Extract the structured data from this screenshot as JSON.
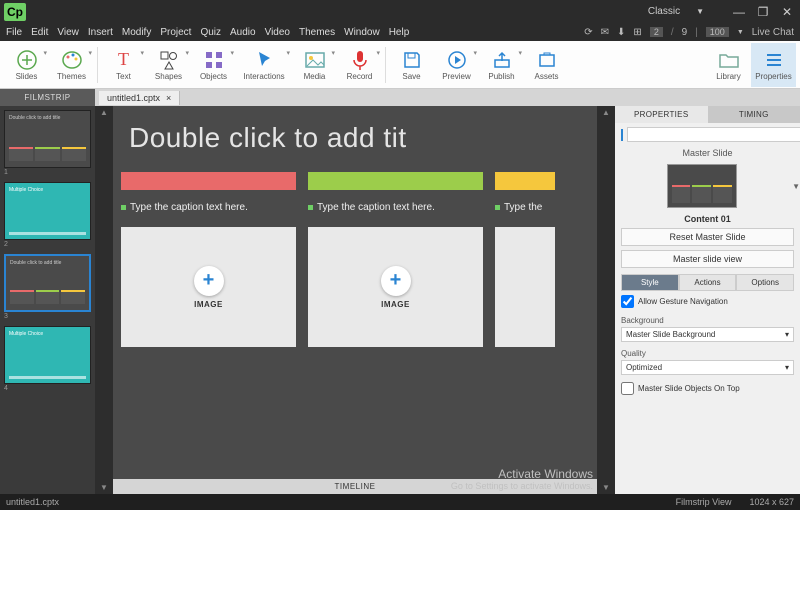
{
  "app_logo": "Cp",
  "workspace": {
    "label": "Classic"
  },
  "window_buttons": {
    "min": "—",
    "restore": "❐",
    "close": "✕"
  },
  "menus": [
    "File",
    "Edit",
    "View",
    "Insert",
    "Modify",
    "Project",
    "Quiz",
    "Audio",
    "Video",
    "Themes",
    "Window",
    "Help"
  ],
  "menu_right": {
    "current": "2",
    "total": "9",
    "zoom": "100",
    "live_chat": "Live Chat"
  },
  "ribbon": [
    {
      "label": "Slides",
      "icon": "plus",
      "color": "#5aa84e"
    },
    {
      "label": "Themes",
      "icon": "palette",
      "color": "#5aa84e"
    },
    {
      "gap": true
    },
    {
      "label": "Text",
      "icon": "T",
      "color": "#d44"
    },
    {
      "label": "Shapes",
      "icon": "shapes",
      "color": "#333"
    },
    {
      "label": "Objects",
      "icon": "grid",
      "color": "#866bc7"
    },
    {
      "label": "Interactions",
      "icon": "cursor",
      "color": "#2a84d2"
    },
    {
      "label": "Media",
      "icon": "image",
      "color": "#6aa"
    },
    {
      "label": "Record",
      "icon": "mic",
      "color": "#d33"
    },
    {
      "gap": true
    },
    {
      "label": "Save",
      "icon": "floppy",
      "color": "#2a84d2"
    },
    {
      "label": "Preview",
      "icon": "play",
      "color": "#2a84d2"
    },
    {
      "label": "Publish",
      "icon": "publish",
      "color": "#2a84d2"
    },
    {
      "label": "Assets",
      "icon": "asset",
      "color": "#2a84d2"
    },
    {
      "spacer": true
    },
    {
      "label": "Library",
      "icon": "folder",
      "color": "#7a9"
    },
    {
      "label": "Properties",
      "icon": "lines",
      "color": "#2a84d2",
      "active": true
    }
  ],
  "filmstrip_header": "FILMSTRIP",
  "document_tab": {
    "name": "untitled1.cptx",
    "close": "×"
  },
  "thumbs": [
    {
      "label": "Double click to add title",
      "type": "cards",
      "sel": true,
      "n": "1"
    },
    {
      "label": "Multiple Choice",
      "type": "quiz",
      "n": "2"
    },
    {
      "label": "Double click to add title",
      "type": "cards",
      "sel": true,
      "n": "3"
    },
    {
      "label": "Multiple Choice",
      "type": "quiz",
      "n": "4"
    }
  ],
  "colors": {
    "red": "#e86a6a",
    "green": "#9ccd4b",
    "yellow": "#f5c73d",
    "teal": "#2fb7b3"
  },
  "canvas": {
    "title": "Double click to add tit",
    "caption": "Type the caption text here.",
    "caption3": "Type the",
    "image_label": "IMAGE"
  },
  "timeline": "TIMELINE",
  "properties": {
    "tabs": [
      "PROPERTIES",
      "TIMING"
    ],
    "name": "",
    "master_heading": "Master Slide",
    "master_name": "Content 01",
    "reset_btn": "Reset Master Slide",
    "view_btn": "Master slide view",
    "subtabs": [
      "Style",
      "Actions",
      "Options"
    ],
    "gesture": "Allow Gesture Navigation",
    "bg_label": "Background",
    "bg_value": "Master Slide Background",
    "quality_label": "Quality",
    "quality_value": "Optimized",
    "ontop": "Master Slide Objects On Top"
  },
  "watermark": {
    "line1": "Activate Windows",
    "line2": "Go to Settings to activate Windows."
  },
  "statusbar": {
    "file": "untitled1.cptx",
    "view": "Filmstrip View",
    "dims": "1024 x 627"
  }
}
